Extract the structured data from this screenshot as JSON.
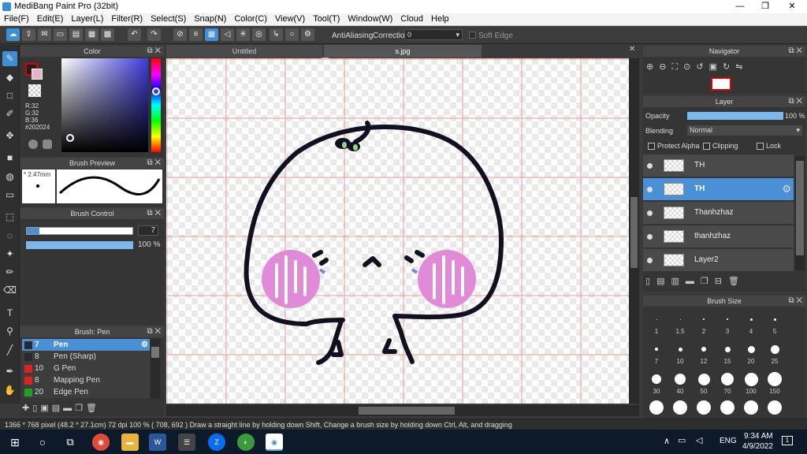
{
  "window": {
    "title": "MediBang Paint Pro (32bit)",
    "minimize": "—",
    "maximize": "❐",
    "close": "✕"
  },
  "menu": [
    "File(F)",
    "Edit(E)",
    "Layer(L)",
    "Filter(R)",
    "Select(S)",
    "Snap(N)",
    "Color(C)",
    "View(V)",
    "Tool(T)",
    "Window(W)",
    "Cloud",
    "Help"
  ],
  "toolbar": {
    "antialiasing": "AntiAliasing",
    "correction_label": "Correction",
    "correction_value": "0",
    "soft_edge": "Soft Edge"
  },
  "tabs": [
    "Untitled",
    "s.jpg"
  ],
  "color_panel": {
    "title": "Color",
    "r": "R:32",
    "g": "G:32",
    "b": "B:36",
    "hex": "#202024",
    "primary": "#202024",
    "accent": "#3f8fd4"
  },
  "brush_preview": {
    "title": "Brush Preview",
    "size": "* 2.47mm"
  },
  "brush_control": {
    "title": "Brush Control",
    "size_value": "7",
    "opacity_value": "100 %"
  },
  "brush_list": {
    "title": "Brush: Pen",
    "items": [
      {
        "color": "#2a2a2a",
        "num": "7",
        "name": "Pen"
      },
      {
        "color": "#2a2a2a",
        "num": "8",
        "name": "Pen (Sharp)"
      },
      {
        "color": "#e02020",
        "num": "10",
        "name": "G Pen"
      },
      {
        "color": "#e02020",
        "num": "8",
        "name": "Mapping Pen"
      },
      {
        "color": "#20a020",
        "num": "20",
        "name": "Edge Pen"
      }
    ]
  },
  "navigator": {
    "title": "Navigator"
  },
  "layer_panel": {
    "title": "Layer",
    "opacity_label": "Opacity",
    "opacity_value": "100 %",
    "blending_label": "Blending",
    "blending_value": "Normal",
    "protect_alpha": "Protect Alpha",
    "clipping": "Clipping",
    "lock": "Lock",
    "layers": [
      "TH",
      "TH",
      "Thanhzhaz",
      "thanhzhaz",
      "Layer2"
    ]
  },
  "brush_size": {
    "title": "Brush Size",
    "sizes": [
      "1",
      "1.5",
      "2",
      "3",
      "4",
      "5",
      "7",
      "10",
      "12",
      "15",
      "20",
      "25",
      "30",
      "40",
      "50",
      "70",
      "100",
      "150"
    ]
  },
  "status": {
    "text": "1366 * 768 pixel   (48.2 * 27.1cm)   72 dpi   100 %   ( 708, 692 )   Draw a straight line by holding down Shift, Change a brush size by holding down Ctrl, Alt, and dragging"
  },
  "taskbar": {
    "lang": "ENG",
    "time": "9:34 AM",
    "date": "4/9/2022",
    "notif": "1"
  }
}
